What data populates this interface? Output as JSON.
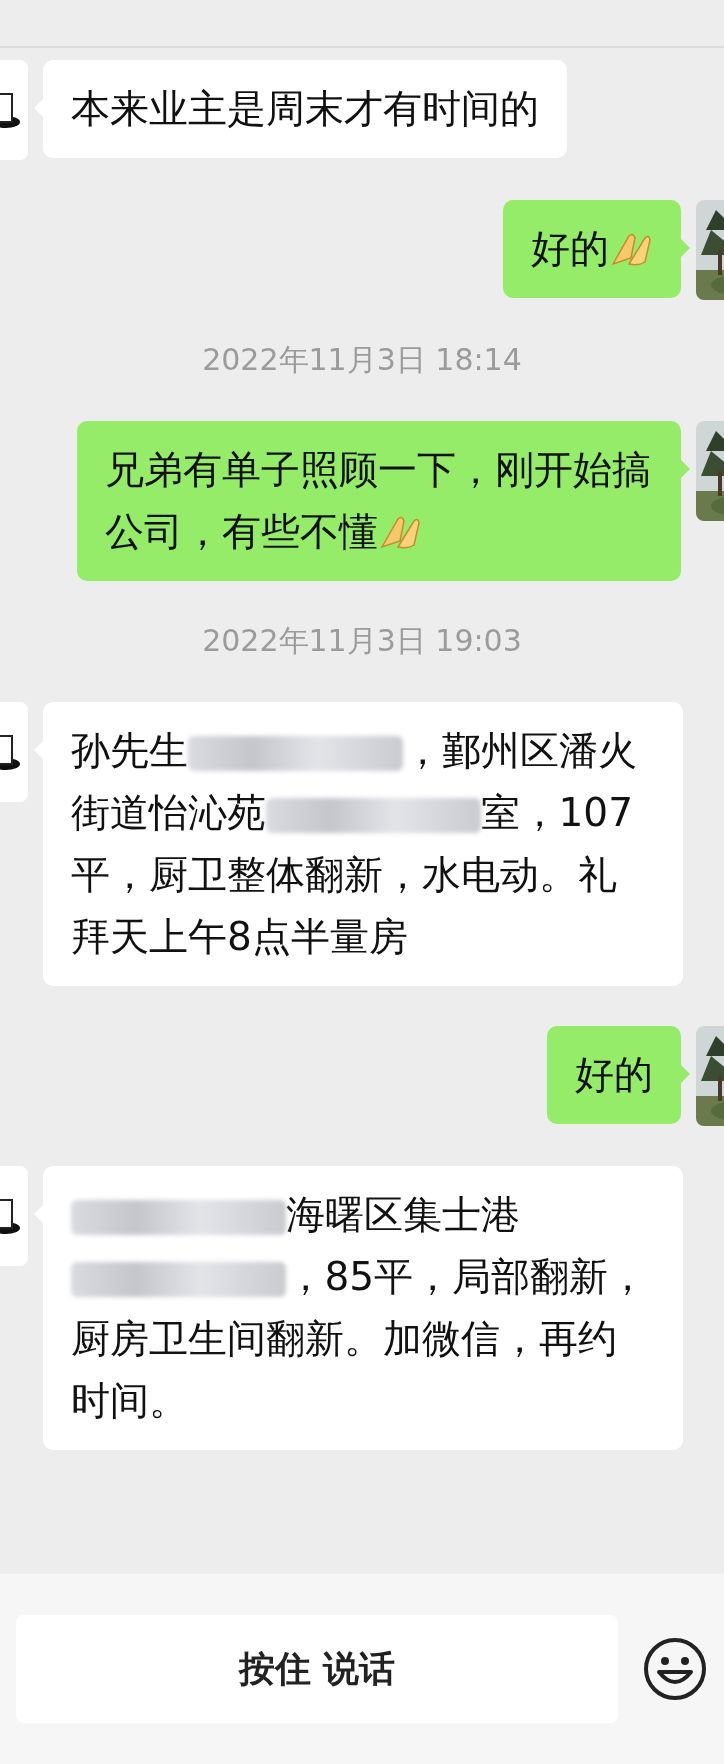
{
  "messages": [
    {
      "kind": "message",
      "outgoing": false,
      "parts": [
        {
          "kind": "text",
          "text": "本来业主是周末才有时间的"
        }
      ]
    },
    {
      "kind": "message",
      "outgoing": true,
      "parts": [
        {
          "kind": "text",
          "text": "好的"
        },
        {
          "kind": "emoji"
        }
      ]
    },
    {
      "kind": "time",
      "text": "2022年11月3日 18:14"
    },
    {
      "kind": "message",
      "outgoing": true,
      "parts": [
        {
          "kind": "text",
          "text": "兄弟有单子照顾一下，刚开始搞公司，有些不懂"
        },
        {
          "kind": "emoji"
        }
      ]
    },
    {
      "kind": "time",
      "text": "2022年11月3日 19:03"
    },
    {
      "kind": "message",
      "outgoing": false,
      "parts": [
        {
          "kind": "text",
          "text": "孙先生"
        },
        {
          "kind": "redacted"
        },
        {
          "kind": "text",
          "text": "，鄞州区潘火街道怡沁苑"
        },
        {
          "kind": "redacted"
        },
        {
          "kind": "text",
          "text": "室，107平，厨卫整体翻新，水电动。礼拜天上午8点半量房"
        }
      ]
    },
    {
      "kind": "message",
      "outgoing": true,
      "parts": [
        {
          "kind": "text",
          "text": "好的"
        }
      ]
    },
    {
      "kind": "message",
      "outgoing": false,
      "parts": [
        {
          "kind": "redacted"
        },
        {
          "kind": "text",
          "text": "海曙区集士港"
        },
        {
          "kind": "redacted"
        },
        {
          "kind": "text",
          "text": "，85平，局部翻新，厨房卫生间翻新。加微信，再约时间。"
        }
      ]
    }
  ],
  "input_bar": {
    "voice_button": "按住 说话"
  }
}
